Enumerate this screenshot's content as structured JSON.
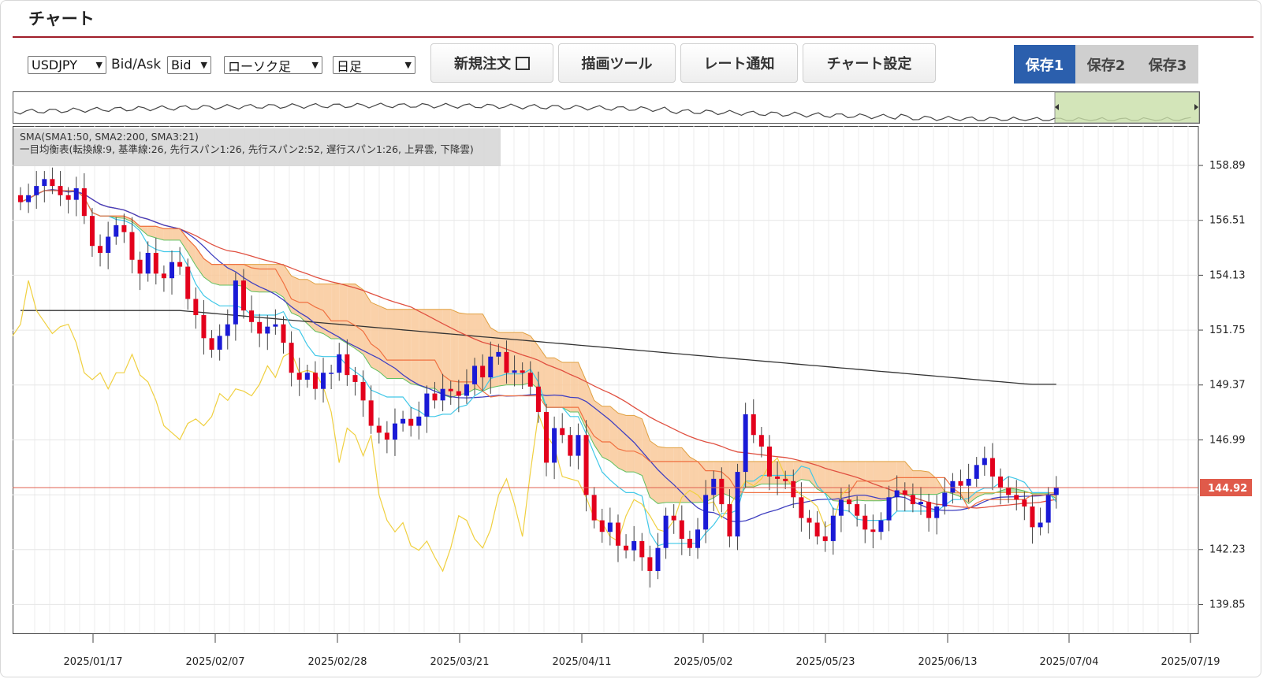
{
  "page_title": "チャート",
  "toolbar": {
    "pair": "USDJPY",
    "bidask_label": "Bid/Ask",
    "bidask": "Bid",
    "chart_type": "ローソク足",
    "period": "日足",
    "new_order_label": "新規注文",
    "drawing_tool_label": "描画ツール",
    "rate_alert_label": "レート通知",
    "chart_settings_label": "チャート設定",
    "save_buttons": [
      "保存1",
      "保存2",
      "保存3"
    ],
    "active_save": "保存1"
  },
  "indicators": {
    "line1": "SMA(SMA1:50, SMA2:200, SMA3:21)",
    "line2": "一目均衡表(転換線:9, 基準線:26, 先行スパン1:26, 先行スパン2:52, 遅行スパン1:26, 上昇雲, 下降雲)"
  },
  "colors": {
    "up_candle": "#1a1ad6",
    "down_candle": "#e3001c",
    "sma50": "#e05040",
    "sma200": "#333333",
    "sma21": "#4040c0",
    "tenkan": "#40c8e8",
    "kijun": "#f07040",
    "chikou": "#f0d040",
    "cloud_up": "#a8e0a8",
    "cloud_down": "#f9c99a",
    "price_line": "#e06050",
    "accent": "#a01e2a",
    "save_active": "#2b5fad"
  },
  "chart_data": {
    "type": "candlestick",
    "symbol": "USDJPY",
    "current_price": "144.92",
    "y_ticks": [
      "158.89",
      "156.51",
      "154.13",
      "151.75",
      "149.37",
      "146.99",
      "142.23",
      "139.85"
    ],
    "x_ticks": [
      "2025/01/17",
      "2025/02/07",
      "2025/02/28",
      "2025/03/21",
      "2025/04/11",
      "2025/05/02",
      "2025/05/23",
      "2025/06/13",
      "2025/07/04",
      "2025/07/19"
    ],
    "ylim": [
      138.6,
      160.6
    ],
    "candles_close": [
      157.3,
      157.6,
      158.0,
      158.3,
      158.0,
      157.6,
      157.4,
      157.9,
      156.7,
      155.4,
      155.1,
      155.8,
      156.3,
      156.0,
      154.8,
      154.2,
      155.1,
      154.2,
      154.0,
      154.7,
      154.5,
      153.1,
      152.4,
      151.4,
      150.9,
      151.5,
      152.0,
      153.9,
      152.6,
      152.1,
      151.6,
      151.9,
      152.0,
      151.2,
      149.9,
      149.6,
      149.9,
      149.2,
      149.9,
      149.9,
      150.7,
      149.8,
      149.5,
      148.7,
      147.6,
      147.3,
      147.0,
      147.7,
      147.9,
      147.6,
      148.0,
      149.0,
      148.7,
      149.2,
      149.1,
      148.9,
      149.4,
      150.2,
      149.7,
      150.6,
      150.8,
      149.9,
      150.0,
      149.9,
      149.3,
      148.2,
      146.0,
      147.5,
      147.2,
      146.3,
      147.2,
      144.6,
      143.5,
      143.0,
      143.4,
      142.4,
      142.2,
      142.6,
      141.9,
      141.3,
      142.3,
      143.7,
      143.5,
      142.7,
      142.3,
      143.1,
      144.6,
      145.3,
      144.2,
      142.8,
      145.6,
      148.1,
      147.2,
      146.7,
      145.4,
      145.3,
      145.2,
      144.5,
      143.6,
      143.4,
      142.8,
      142.6,
      143.7,
      144.4,
      144.2,
      143.7,
      143.1,
      143.0,
      143.5,
      144.5,
      144.8,
      144.6,
      144.2,
      144.3,
      143.6,
      144.1,
      144.7,
      145.2,
      145.0,
      145.3,
      145.9,
      146.2,
      145.4,
      144.9,
      144.6,
      144.4,
      144.1,
      143.2,
      143.4,
      144.6,
      144.92
    ],
    "price_range": [
      139.85,
      158.89
    ]
  }
}
